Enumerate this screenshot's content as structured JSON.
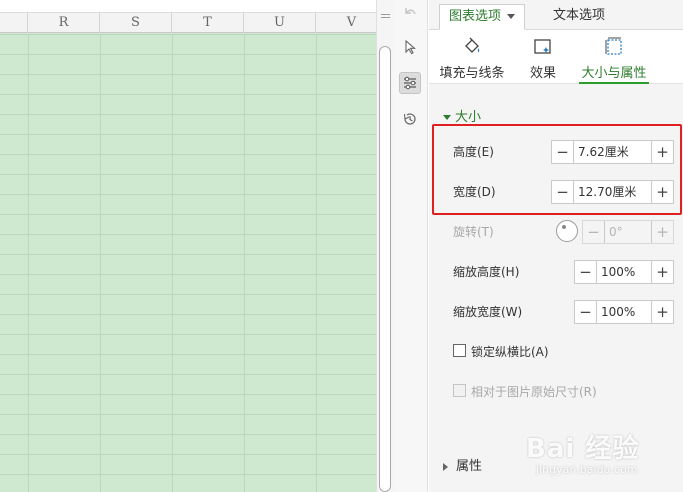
{
  "spreadsheet": {
    "columns": [
      "R",
      "S",
      "T",
      "U",
      "V"
    ]
  },
  "panel": {
    "tabs": {
      "chart_options": "图表选项",
      "text_options": "文本选项"
    },
    "subtabs": {
      "fill_line": "填充与线条",
      "effect": "效果",
      "size_properties": "大小与属性"
    },
    "size_section": {
      "title": "大小",
      "height": {
        "label": "高度(E)",
        "value": "7.62厘米"
      },
      "width": {
        "label": "宽度(D)",
        "value": "12.70厘米"
      },
      "rotation": {
        "label": "旋转(T)",
        "value": "0°"
      },
      "scale_height": {
        "label": "缩放高度(H)",
        "value": "100%"
      },
      "scale_width": {
        "label": "缩放宽度(W)",
        "value": "100%"
      },
      "lock_aspect": {
        "label": "锁定纵横比(A)"
      },
      "relative_original": {
        "label": "相对于图片原始尺寸(R)"
      }
    },
    "properties_section": {
      "title": "属性"
    }
  },
  "watermark": {
    "main": "Bai 经验",
    "sub": "jingyan.baidu.com"
  },
  "colors": {
    "accent": "#2d7d2d",
    "highlight": "#e02020",
    "sheet_fill": "#cfe8d0"
  },
  "icons": {
    "toolstrip": [
      "undo-icon",
      "select-pointer-icon",
      "properties-settings-icon",
      "history-icon"
    ],
    "subtabs": [
      "fill-bucket-icon",
      "effect-icon",
      "size-frame-icon"
    ]
  }
}
